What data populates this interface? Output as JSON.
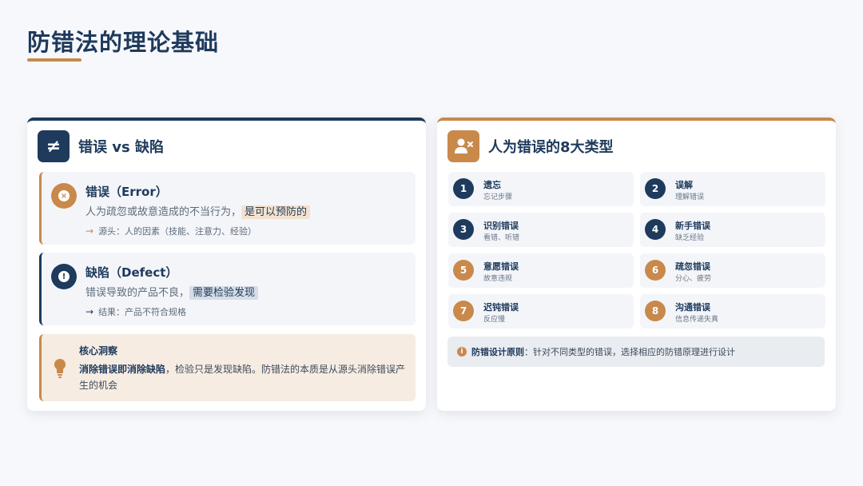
{
  "page": {
    "title": "防错法的理论基础"
  },
  "left_card": {
    "icon": "not-equal-icon",
    "icon_glyph": "≠",
    "title": "错误 vs 缺陷",
    "error": {
      "icon": "x-circle-icon",
      "title": "错误（Error）",
      "desc_main": "人为疏忽或故意造成的不当行为，",
      "desc_highlight": "是可以预防的",
      "note": "源头：人的因素（技能、注意力、经验）"
    },
    "defect": {
      "icon": "exclamation-circle-icon",
      "title": "缺陷（Defect）",
      "desc_main": "错误导致的产品不良，",
      "desc_highlight": "需要检验发现",
      "note": "结果：产品不符合规格"
    },
    "insight": {
      "icon": "lightbulb-icon",
      "title": "核心洞察",
      "text_bold": "消除错误即消除缺陷",
      "text_rest": "，检验只是发现缺陷。防错法的本质是从源头消除错误产生的机会"
    }
  },
  "right_card": {
    "icon": "user-x-icon",
    "title": "人为错误的8大类型",
    "types": [
      {
        "num": "1",
        "name": "遗忘",
        "desc": "忘记步骤",
        "color": "navy"
      },
      {
        "num": "2",
        "name": "误解",
        "desc": "理解错误",
        "color": "navy"
      },
      {
        "num": "3",
        "name": "识别错误",
        "desc": "看错、听错",
        "color": "navy"
      },
      {
        "num": "4",
        "name": "新手错误",
        "desc": "缺乏经验",
        "color": "navy"
      },
      {
        "num": "5",
        "name": "意愿错误",
        "desc": "故意违规",
        "color": "gold"
      },
      {
        "num": "6",
        "name": "疏忽错误",
        "desc": "分心、疲劳",
        "color": "gold"
      },
      {
        "num": "7",
        "name": "迟钝错误",
        "desc": "反应慢",
        "color": "gold"
      },
      {
        "num": "8",
        "name": "沟通错误",
        "desc": "信息传递失真",
        "color": "gold"
      }
    ],
    "principle": {
      "icon": "info-icon",
      "label": "防错设计原则",
      "text": "：针对不同类型的错误，选择相应的防错原理进行设计"
    }
  },
  "colors": {
    "navy": "#1e3a5c",
    "gold": "#c8894b"
  }
}
